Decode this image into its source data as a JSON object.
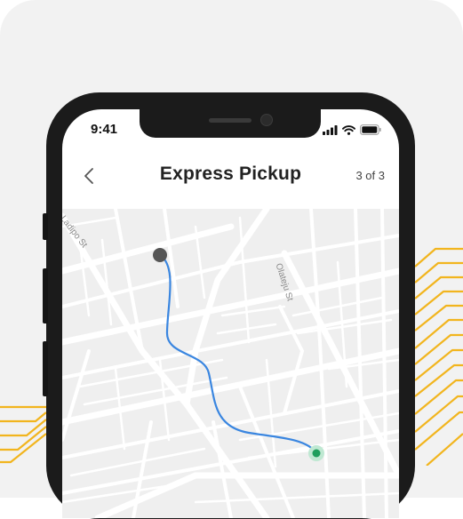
{
  "status_bar": {
    "time": "9:41"
  },
  "header": {
    "title": "Express Pickup",
    "step": "3 of 3"
  },
  "map": {
    "streets": [
      "Ladipo St",
      "Olateju St"
    ],
    "route_color": "#3a86e0",
    "start_marker_color": "#555555",
    "end_marker_color": "#1d9e5c"
  },
  "icons": [
    "back-chevron-icon",
    "signal-icon",
    "wifi-icon",
    "battery-icon"
  ],
  "colors": {
    "accent_lines": "#f2b51e",
    "background": "#f2f2f2",
    "phone_body": "#1b1b1b"
  }
}
